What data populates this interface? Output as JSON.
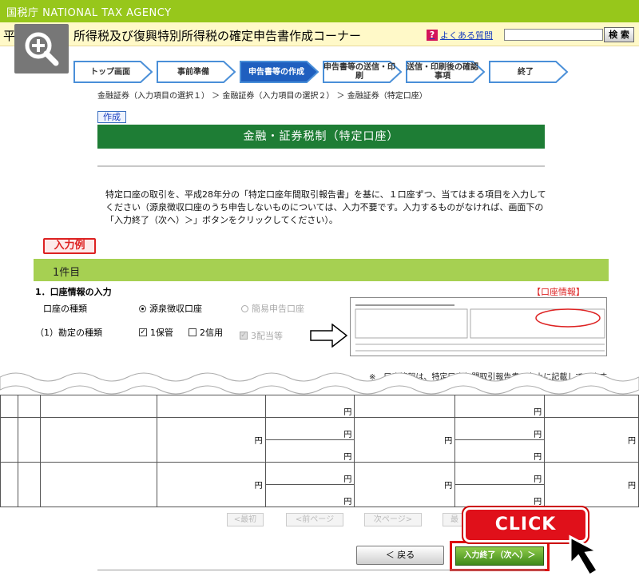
{
  "header": {
    "agency": "国税庁 NATIONAL TAX AGENCY",
    "hei_char": "平",
    "title": "所得税及び復興特別所得税の確定申告書作成コーナー",
    "faq": "よくある質問",
    "faq_icon": "?",
    "search_label": "検 索",
    "search_placeholder": ""
  },
  "steps": [
    "トップ画面",
    "事前準備",
    "申告書等の作成",
    "申告書等の送信・印刷",
    "送信・印刷後の確認事項",
    "終了"
  ],
  "breadcrumb": "金融証券（入力項目の選択１） ＞ 金融証券（入力項目の選択２） ＞ 金融証券（特定口座）",
  "sakusei": "作成",
  "page_title": "金融・証券税制（特定口座）",
  "instructions": "特定口座の取引を、平成28年分の「特定口座年間取引報告書」を基に、１口座ずつ、当てはまる項目を入力してください（源泉徴収口座のうち申告しないものについては、入力不要です。入力するものがなければ、画面下の「入力終了（次へ）＞」ボタンをクリックしてください）。",
  "example_label": "入力例",
  "ken_label": "1件目",
  "section": {
    "heading": "1．口座情報の入力",
    "info_tag": "【口座情報】",
    "account_type_label": "口座の種類",
    "radio_gensen": "源泉徴収口座",
    "radio_kani": "簡易申告口座",
    "kanjo_label": "（1）勘定の種類",
    "chk_hokan": "1保管",
    "chk_shinyo": "2信用",
    "chk_haito": "3配当等",
    "note": "※　口座情報は、特定口座年間取引報告書の左上に記載しています"
  },
  "en": "円",
  "pager": [
    "<最初",
    "<前ページ",
    "次ページ>",
    "最"
  ],
  "buttons": {
    "back": "＜ 戻る",
    "next": "入力終了（次へ）＞"
  },
  "click_label": "CLICK",
  "colors": {
    "topbar": "#97c71b",
    "title_green": "#1e7d35",
    "ken_bar": "#a6d052",
    "click_red": "#e0101a"
  }
}
